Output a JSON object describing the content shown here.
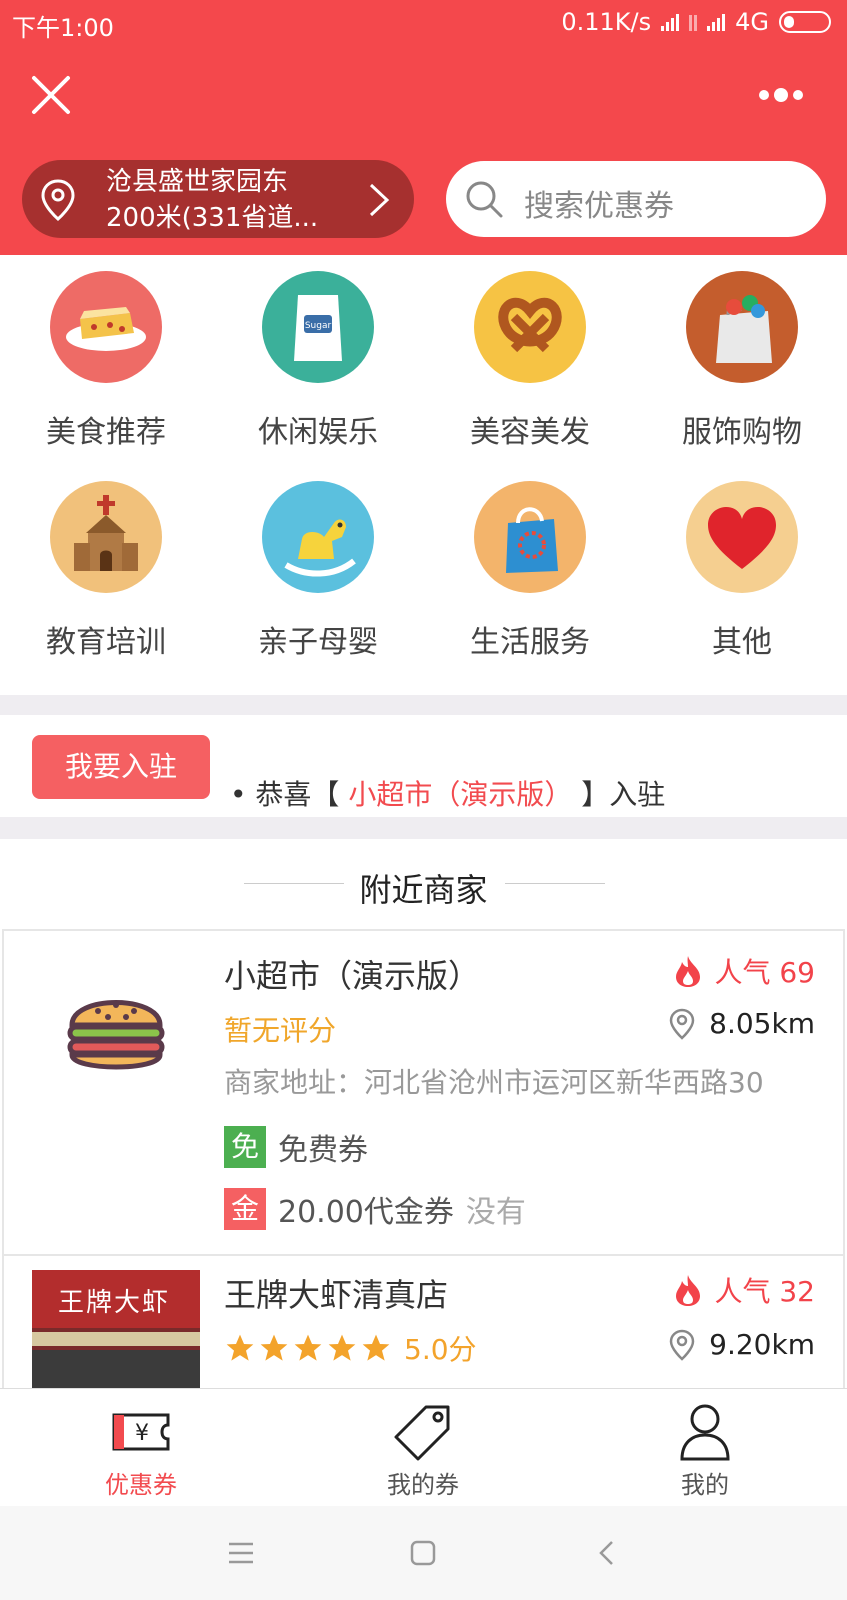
{
  "status_bar": {
    "time": "下午1:00",
    "speed": "0.11K/s",
    "network": "4G"
  },
  "header": {
    "location_line1": "沧县盛世家园东",
    "location_line2": "200米(331省道...",
    "search_placeholder": "搜索优惠券"
  },
  "categories": [
    {
      "label": "美食推荐",
      "icon": "cake-icon",
      "color": "#ee6b66"
    },
    {
      "label": "休闲娱乐",
      "icon": "sugar-bag-icon",
      "color": "#3bb09a"
    },
    {
      "label": "美容美发",
      "icon": "pretzel-icon",
      "color": "#f6c344"
    },
    {
      "label": "服饰购物",
      "icon": "gift-bag-icon",
      "color": "#c45d2d"
    },
    {
      "label": "教育培训",
      "icon": "church-icon",
      "color": "#f1c17b"
    },
    {
      "label": "亲子母婴",
      "icon": "rocking-horse-icon",
      "color": "#5bc0de"
    },
    {
      "label": "生活服务",
      "icon": "shopping-bag-icon",
      "color": "#f3b46b"
    },
    {
      "label": "其他",
      "icon": "heart-icon",
      "color": "#f5cf90"
    }
  ],
  "join": {
    "button_label": "我要入驻",
    "news_prefix": "• 恭喜【",
    "news_highlight": "小超市（演示版）",
    "news_suffix": "】入驻"
  },
  "section_title": "附近商家",
  "merchants": [
    {
      "name": "小超市（演示版）",
      "popularity": "人气 69",
      "distance": "8.05km",
      "rating_text": "暂无评分",
      "address": "商家地址：河北省沧州市运河区新华西路30",
      "coupons": [
        {
          "tag": "免",
          "tag_color": "#4caf50",
          "label": "免费券",
          "note": ""
        },
        {
          "tag": "金",
          "tag_color": "#f56062",
          "label": "20.00代金券",
          "note": "没有"
        }
      ]
    },
    {
      "name": "王牌大虾清真店",
      "popularity": "人气 32",
      "distance": "9.20km",
      "stars": 5,
      "score": "5.0分",
      "storefront_sign": "王牌大虾"
    }
  ],
  "tabbar": {
    "tabs": [
      {
        "label": "优惠券",
        "active": true
      },
      {
        "label": "我的券",
        "active": false
      },
      {
        "label": "我的",
        "active": false
      }
    ]
  },
  "colors": {
    "brand_red": "#f4484c",
    "highlight_red": "#f24b4f",
    "orange": "#f0a62a"
  }
}
